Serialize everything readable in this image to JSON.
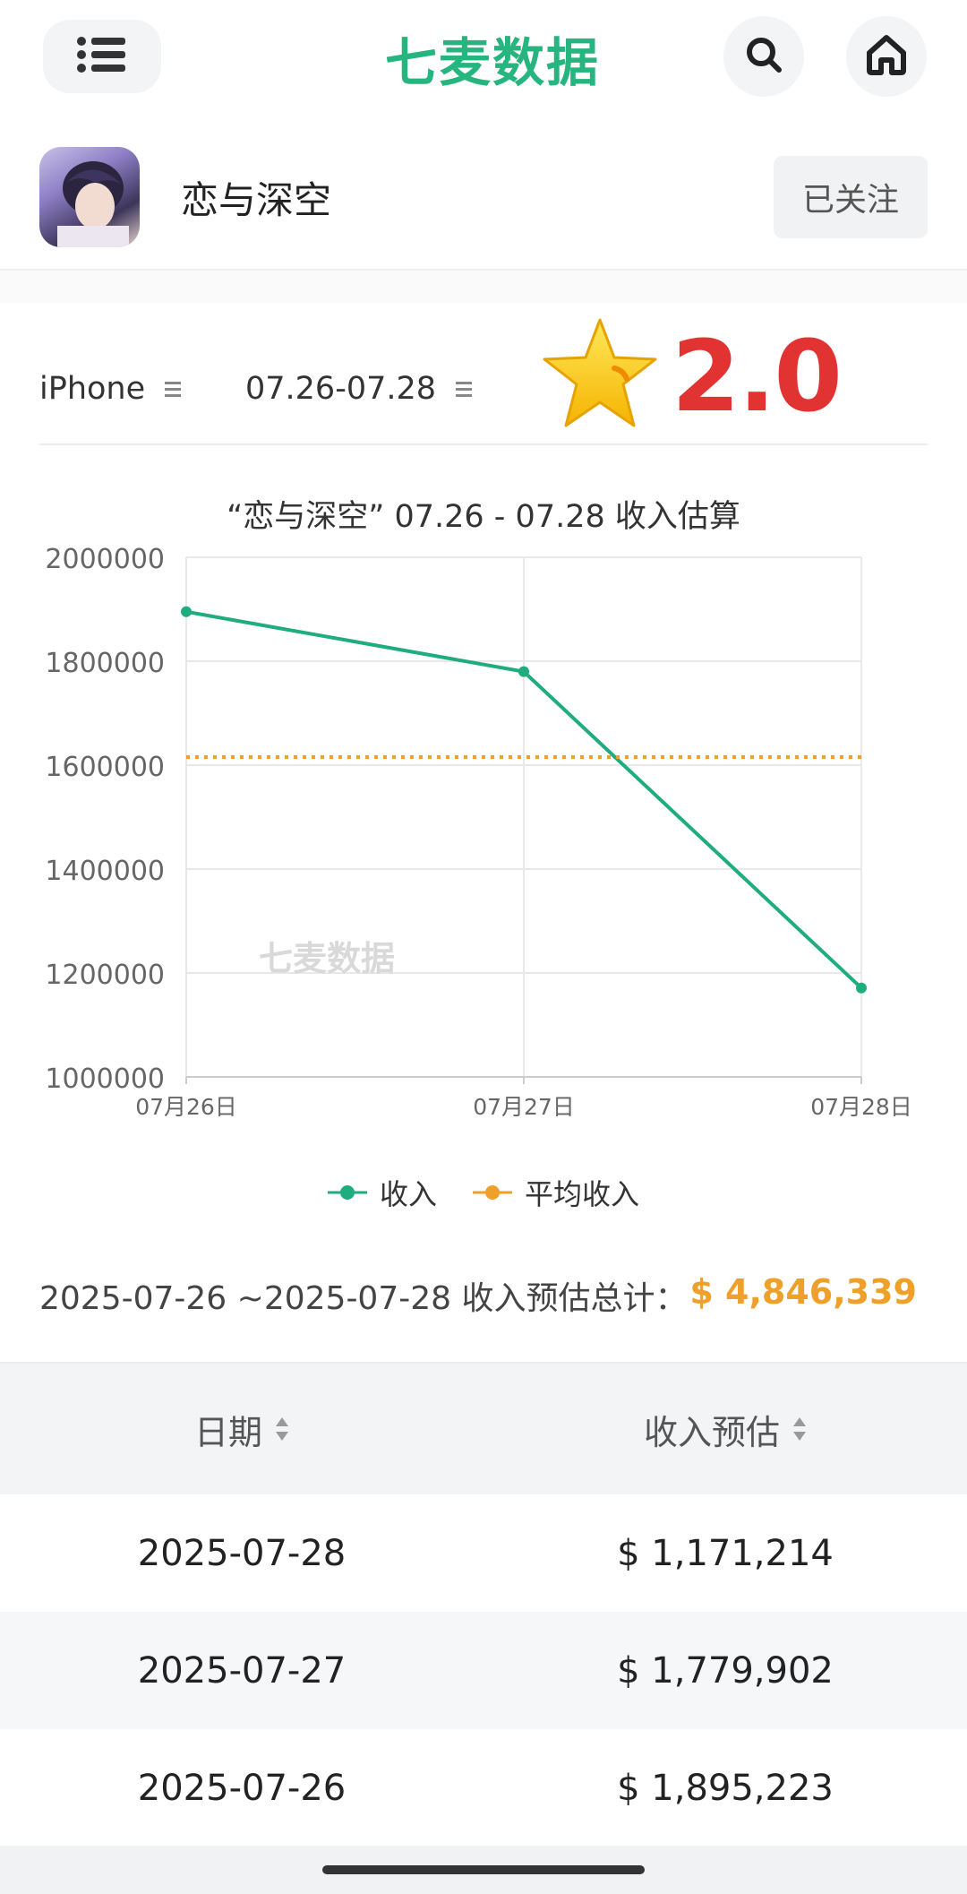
{
  "brand": {
    "name": "七麦数据",
    "color": "#26b57e"
  },
  "header": {
    "menu_icon": "list-icon",
    "search_icon": "search-icon",
    "home_icon": "home-icon"
  },
  "app": {
    "name": "恋与深空",
    "follow_label": "已关注"
  },
  "filters": {
    "device": "iPhone",
    "date_range": "07.26-07.28"
  },
  "rating": {
    "value": "2.0",
    "icon": "star-icon",
    "color": "#e23333"
  },
  "legend": {
    "income": "收入",
    "average": "平均收入"
  },
  "summary": {
    "label": "2025-07-26 ~2025-07-28 收入预估总计：",
    "total": "$ 4,846,339"
  },
  "table": {
    "headers": [
      "日期",
      "收入预估"
    ],
    "rows": [
      {
        "date": "2025-07-28",
        "revenue": "$ 1,171,214"
      },
      {
        "date": "2025-07-27",
        "revenue": "$ 1,779,902"
      },
      {
        "date": "2025-07-26",
        "revenue": "$ 1,895,223"
      }
    ]
  },
  "chart_data": {
    "type": "line",
    "title": "“恋与深空” 07.26 - 07.28 收入估算",
    "watermark": "七麦数据",
    "categories": [
      "07月26日",
      "07月27日",
      "07月28日"
    ],
    "series": [
      {
        "name": "收入",
        "values": [
          1895223,
          1779902,
          1171214
        ],
        "color": "#1fac7f"
      },
      {
        "name": "平均收入",
        "values": [
          1615446,
          1615446,
          1615446
        ],
        "color": "#efa02b",
        "style": "dotted"
      }
    ],
    "ylim": [
      1000000,
      2000000
    ],
    "yticks": [
      "2000000",
      "1800000",
      "1600000",
      "1400000",
      "1200000",
      "1000000"
    ],
    "grid": true,
    "legend_position": "bottom"
  }
}
